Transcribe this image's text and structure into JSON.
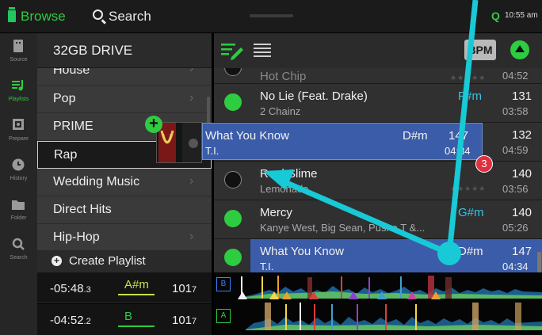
{
  "topbar": {
    "browse_label": "Browse",
    "search_label": "Search",
    "q_label": "Q",
    "clock": "10:55 am"
  },
  "sidebar": {
    "items": [
      {
        "label": "Source",
        "icon": "usb-drive-icon"
      },
      {
        "label": "Playlists",
        "icon": "playlist-icon",
        "active": true
      },
      {
        "label": "Prepare",
        "icon": "prepare-icon"
      },
      {
        "label": "History",
        "icon": "clock-icon"
      },
      {
        "label": "Folder",
        "icon": "folder-icon"
      },
      {
        "label": "Search",
        "icon": "search-icon"
      }
    ]
  },
  "crates": {
    "title": "32GB DRIVE",
    "items": [
      "House",
      "Pop",
      "PRIME",
      "Rap",
      "Wedding Music",
      "Direct Hits",
      "Hip-Hop"
    ],
    "selected": "Rap",
    "create_label": "Create Playlist"
  },
  "decks": [
    {
      "time": "-05:48",
      "time_small": ".3",
      "key": "A#m",
      "key_color": "#c8e04a",
      "bpm": "101",
      "bpm_small": "7",
      "tag": "B",
      "tag_color": "#3b82f6"
    },
    {
      "time": "-04:52",
      "time_small": ".2",
      "key": "B",
      "key_color": "#2ecc40",
      "bpm": "101",
      "bpm_small": "7",
      "tag": "A",
      "tag_color": "#2ecc40"
    }
  ],
  "tracks_header": {
    "bpm_button": "BPM"
  },
  "tracks": [
    {
      "title": "Hot Chip",
      "artist": "",
      "key": "",
      "bpm": "",
      "duration": "04:52",
      "dot": "none",
      "stars": "★★★★★"
    },
    {
      "title": "No Lie (Feat. Drake)",
      "artist": "2 Chainz",
      "key": "F#m",
      "bpm": "131",
      "duration": "03:58",
      "dot": "green",
      "stars": ""
    },
    {
      "title": "",
      "artist": "",
      "key": "",
      "bpm": "132",
      "duration": "04:59",
      "dot": "green",
      "stars": ""
    },
    {
      "title": "Real Slime",
      "artist": "Lemonade",
      "key": "",
      "bpm": "140",
      "duration": "03:56",
      "dot": "empty",
      "stars": "★★★★★"
    },
    {
      "title": "Mercy",
      "artist": "Kanye West, Big Sean, Pusha T &...",
      "key": "G#m",
      "bpm": "140",
      "duration": "05:26",
      "dot": "green",
      "stars": ""
    },
    {
      "title": "What You Know",
      "artist": "T.I.",
      "key": "D#m",
      "bpm": "147",
      "duration": "04:34",
      "dot": "green",
      "stars": "",
      "highlight": true
    }
  ],
  "drag": {
    "title": "What You Know",
    "artist": "T.I.",
    "key": "D#m",
    "bpm": "147",
    "duration": "04:34",
    "count": "3"
  },
  "colors": {
    "accent": "#2ecc40",
    "highlight": "#3b5ca8",
    "key_cyan": "#35c4e8",
    "arrow": "#18c9d6"
  }
}
